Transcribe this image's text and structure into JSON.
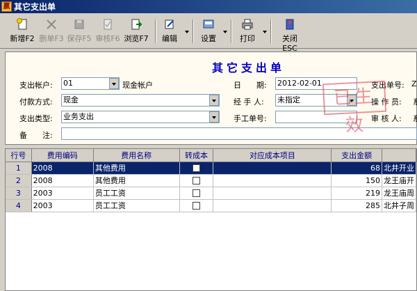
{
  "window": {
    "title": "其它支出单",
    "icon_glyph": "赢"
  },
  "toolbar": {
    "new": "新增F2",
    "delete": "删单F3",
    "save": "保存F5",
    "audit": "审核F6",
    "browse": "浏览F7",
    "edit": "编辑",
    "settings": "设置",
    "print": "打印",
    "close": "关闭ESC"
  },
  "form": {
    "title": "其它支出单",
    "account_label": "支出帐户:",
    "account_code": "01",
    "account_name": "现金帐户",
    "date_label": "日　　期:",
    "date_value": "2012-02-01",
    "doc_no_label": "支出单号:",
    "doc_no_value": "ZC",
    "pay_method_label": "付款方式:",
    "pay_method_value": "现金",
    "handler_label": "经 手 人:",
    "handler_value": "未指定",
    "operator_label": "操 作 员:",
    "operator_value": "系",
    "type_label": "支出类型:",
    "type_value": "业务支出",
    "manual_no_label": "手工单号:",
    "manual_no_value": "",
    "auditor_label": "审 核 人:",
    "auditor_value": "系",
    "remark_label": "备　　注:",
    "remark_value": ""
  },
  "stamp": "已生效",
  "table": {
    "headers": [
      "行号",
      "费用编码",
      "费用名称",
      "转成本",
      "对应成本项目",
      "支出金额",
      ""
    ],
    "rows": [
      {
        "no": "1",
        "code": "2008",
        "name": "其他费用",
        "cost": "",
        "amount": "68",
        "extra": "北井开业"
      },
      {
        "no": "2",
        "code": "2008",
        "name": "其他费用",
        "cost": "",
        "amount": "150",
        "extra": "龙王庙开"
      },
      {
        "no": "3",
        "code": "2003",
        "name": "员工工资",
        "cost": "",
        "amount": "219",
        "extra": "龙王庙周"
      },
      {
        "no": "4",
        "code": "2003",
        "name": "员工工资",
        "cost": "",
        "amount": "285",
        "extra": "北井子周"
      }
    ]
  }
}
